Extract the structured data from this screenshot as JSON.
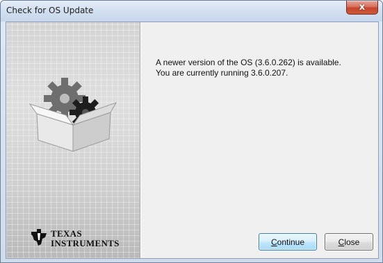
{
  "window": {
    "title": "Check for OS Update",
    "close_glyph": "x",
    "close_icon": "close-icon"
  },
  "message": {
    "line1": "A newer version of the OS (3.6.0.262) is available.",
    "line2": "You are currently running 3.6.0.207."
  },
  "illustration": {
    "icon": "software-box-with-gears-icon"
  },
  "logo": {
    "name": "Texas Instruments",
    "line1": "TEXAS",
    "line2": "INSTRUMENTS",
    "icon": "texas-instruments-logo-icon"
  },
  "buttons": {
    "continue_label": "Continue",
    "continue_mnemonic": "C",
    "continue_rest": "ontinue",
    "close_label": "Close",
    "close_mnemonic": "C",
    "close_rest": "lose"
  },
  "colors": {
    "titlebar": "#d2dff0",
    "close_button": "#c4452b",
    "default_button_border": "#3c7fb1",
    "right_panel_bg": "#f0f0f0"
  }
}
